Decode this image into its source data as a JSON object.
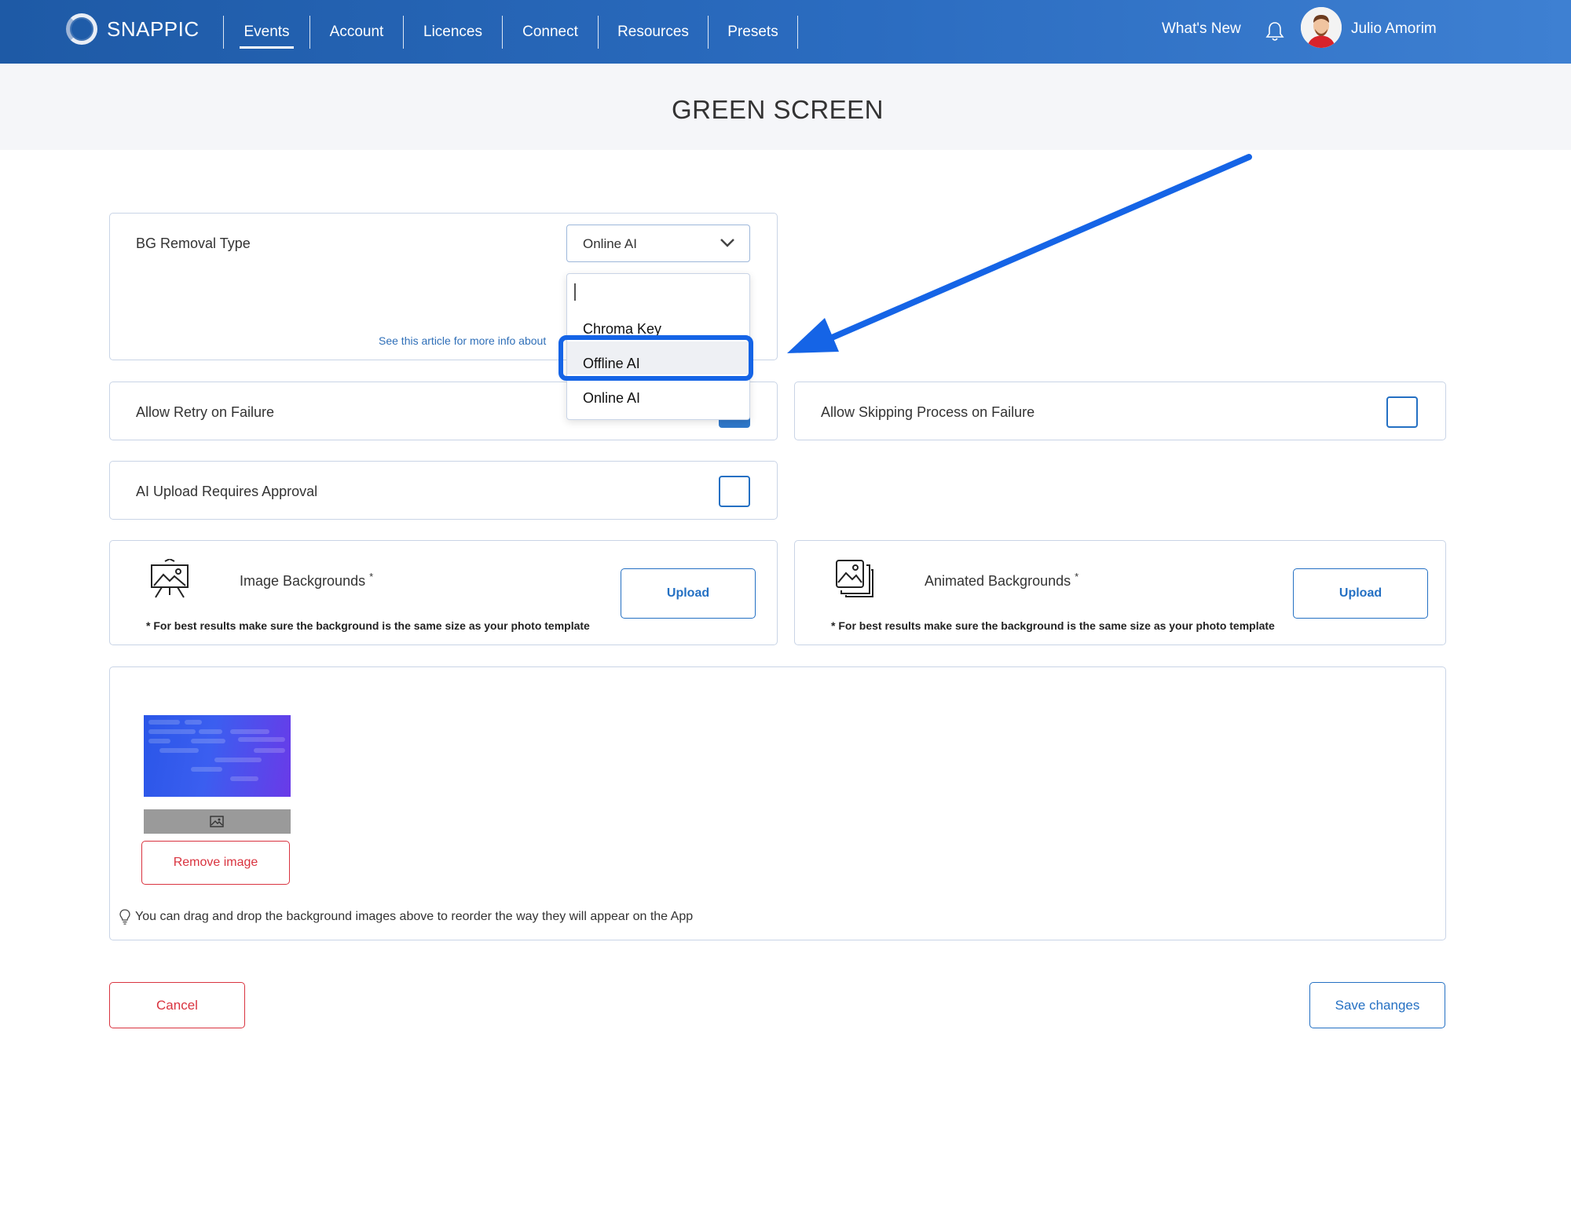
{
  "app": {
    "brand": "SNAPPIC"
  },
  "nav": {
    "items": [
      {
        "label": "Events",
        "active": true
      },
      {
        "label": "Account"
      },
      {
        "label": "Licences"
      },
      {
        "label": "Connect"
      },
      {
        "label": "Resources"
      },
      {
        "label": "Presets"
      }
    ],
    "whats_new": "What's New",
    "user_name": "Julio Amorim"
  },
  "page": {
    "title": "GREEN SCREEN"
  },
  "bg_removal": {
    "label": "BG Removal Type",
    "selected": "Online AI",
    "info_text": "See this article for more info about",
    "options": [
      "Chroma Key",
      "Offline AI",
      "Online AI"
    ],
    "highlighted_option": "Offline AI"
  },
  "settings": {
    "allow_retry": "Allow Retry on Failure",
    "allow_skipping": "Allow Skipping Process on Failure",
    "ai_upload_approval": "AI Upload Requires Approval"
  },
  "backgrounds": {
    "image": {
      "label": "Image Backgrounds",
      "required_mark": "*",
      "upload": "Upload",
      "note": "* For best results make sure the background is the same size as your photo template"
    },
    "animated": {
      "label": "Animated Backgrounds",
      "required_mark": "*",
      "upload": "Upload",
      "note": "* For best results make sure the background is the same size as your photo template"
    }
  },
  "gallery": {
    "remove_label": "Remove image",
    "tip": "You can drag and drop the background images above to reorder the way they will appear on the App"
  },
  "actions": {
    "cancel": "Cancel",
    "save": "Save changes"
  },
  "colors": {
    "primary": "#2470c3",
    "danger": "#d9333f",
    "highlight": "#1564e6",
    "nav_start": "#1e5aa6",
    "nav_end": "#3e80d2"
  }
}
